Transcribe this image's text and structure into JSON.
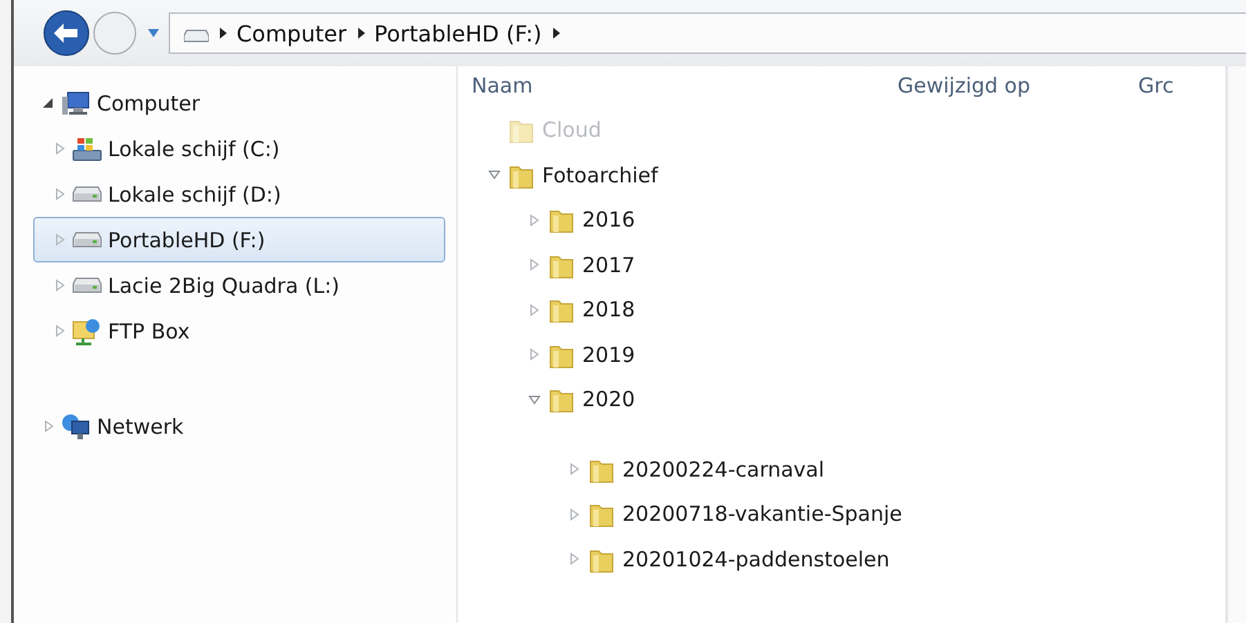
{
  "address_bar": {
    "path": [
      "Computer",
      "PortableHD (F:)"
    ]
  },
  "navigation_pane": {
    "items": [
      {
        "label": "Computer",
        "kind": "computer",
        "expanded": true,
        "selected": false,
        "children": [
          {
            "label": "Lokale schijf (C:)",
            "kind": "system-drive",
            "expanded": false,
            "selected": false
          },
          {
            "label": "Lokale schijf (D:)",
            "kind": "drive",
            "expanded": false,
            "selected": false
          },
          {
            "label": "PortableHD (F:)",
            "kind": "drive",
            "expanded": false,
            "selected": true
          },
          {
            "label": "Lacie 2Big Quadra (L:)",
            "kind": "drive",
            "expanded": false,
            "selected": false
          },
          {
            "label": "FTP Box",
            "kind": "network-location",
            "expanded": false,
            "selected": false
          }
        ]
      },
      {
        "label": "Netwerk",
        "kind": "network",
        "expanded": false,
        "selected": false
      }
    ]
  },
  "file_list": {
    "columns": [
      "Naam",
      "Gewijzigd op",
      "Grc"
    ],
    "items": [
      {
        "name": "Cloud",
        "hidden": true
      },
      {
        "name": "Fotoarchief",
        "hidden": false,
        "expanded": true,
        "children": [
          {
            "name": "2016",
            "hidden": false,
            "expanded": false
          },
          {
            "name": "2017",
            "hidden": false,
            "expanded": false
          },
          {
            "name": "2018",
            "hidden": false,
            "expanded": false
          },
          {
            "name": "2019",
            "hidden": false,
            "expanded": false
          },
          {
            "name": "2020",
            "hidden": false,
            "expanded": true,
            "children": [
              {
                "name": "20200224-carnaval",
                "hidden": false,
                "expanded": false
              },
              {
                "name": "20200718-vakantie-Spanje",
                "hidden": false,
                "expanded": false
              },
              {
                "name": "20201024-paddenstoelen",
                "hidden": false,
                "expanded": false
              }
            ]
          }
        ]
      }
    ]
  }
}
